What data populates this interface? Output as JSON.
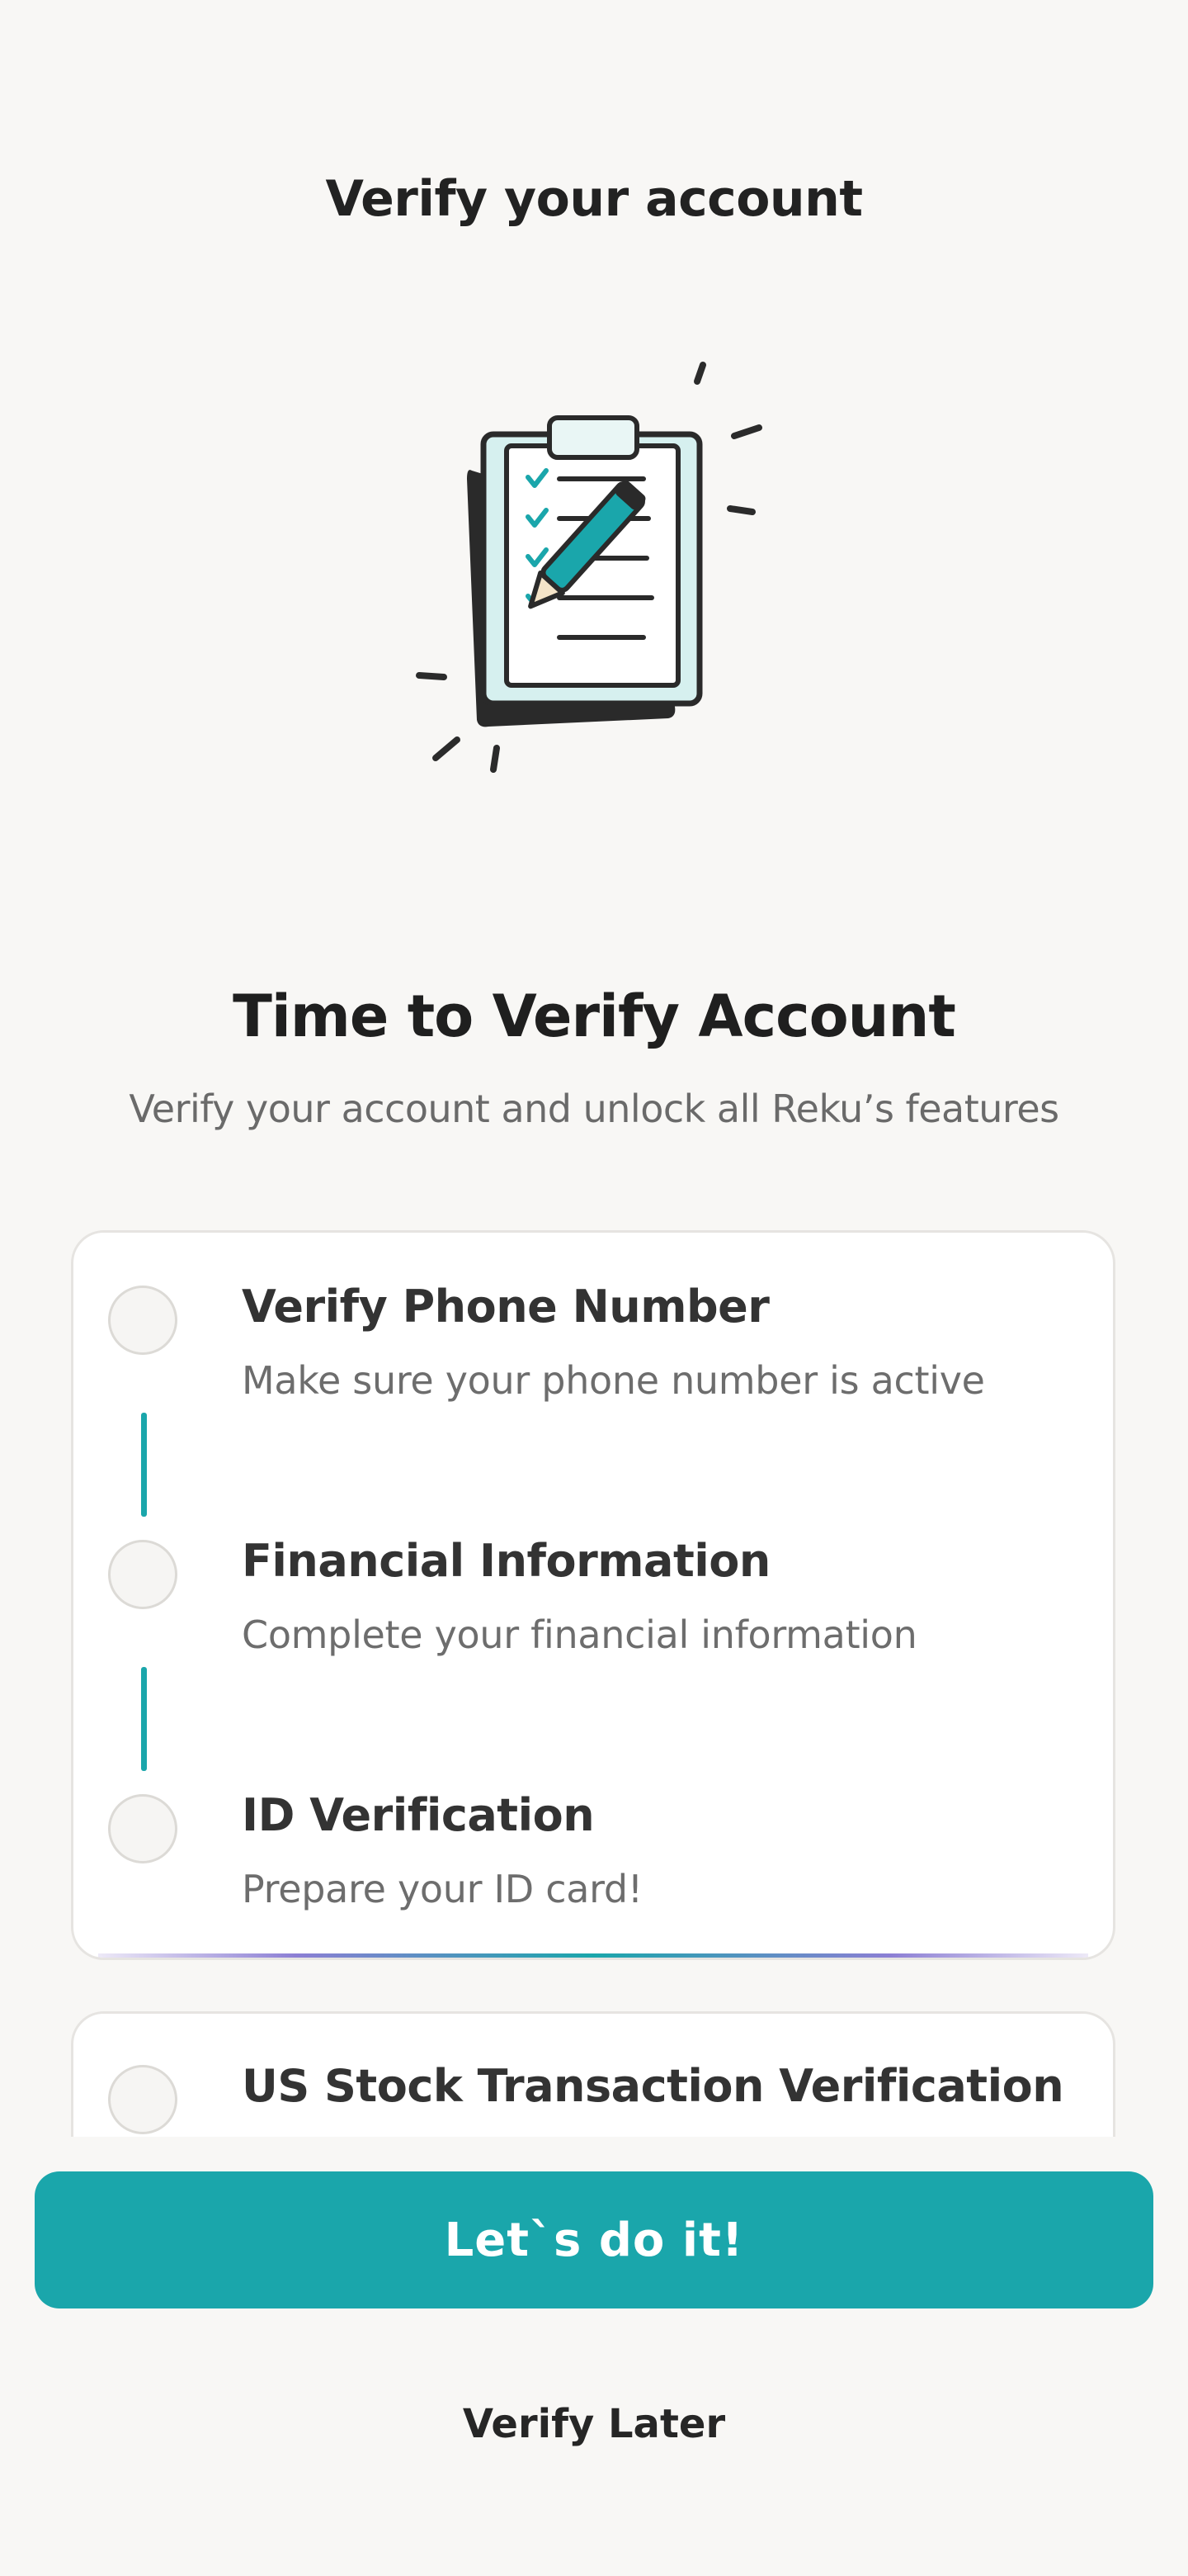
{
  "header": {
    "title": "Verify your account"
  },
  "illustration": {
    "icon": "clipboard-checklist-pencil-icon",
    "accent_color": "#1aa6ab"
  },
  "intro": {
    "title": "Time to Verify Account",
    "subtitle": "Verify your account and unlock all Reku’s features"
  },
  "steps": [
    {
      "title": "Verify Phone Number",
      "description": "Make sure your phone number is active"
    },
    {
      "title": "Financial Information",
      "description": "Complete your financial information"
    },
    {
      "title": "ID Verification",
      "description": "Prepare your ID card!"
    }
  ],
  "extra_step": {
    "title": "US Stock Transaction Verification"
  },
  "actions": {
    "primary_label": "Let`s do it!",
    "secondary_label": "Verify Later"
  },
  "colors": {
    "primary": "#1aa6ab",
    "background": "#f8f7f5"
  }
}
